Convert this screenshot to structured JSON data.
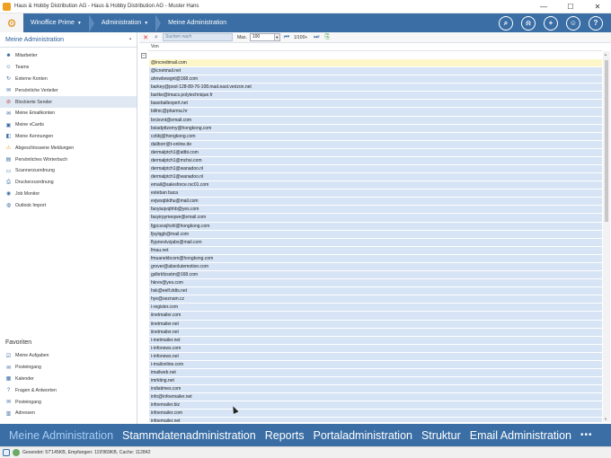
{
  "window": {
    "title": "Haus & Hobby Distribution AG - Haus & Hobby Distribution AG - Muster Hans",
    "minimize": "—",
    "maximize": "☐",
    "close": "✕"
  },
  "topnav": {
    "crumbs": [
      "Winoffice Prime",
      "Administration",
      "Meine Administration"
    ],
    "icons": [
      "search-icon",
      "bell-icon",
      "plus-icon",
      "user-icon",
      "help-icon"
    ],
    "search_glyph": "⌕",
    "bell_glyph": "⍾",
    "plus_glyph": "+",
    "user_glyph": "☺",
    "help_glyph": "?"
  },
  "sidebar": {
    "title": "Meine Administration",
    "pin": "▪",
    "items": [
      {
        "label": "Mitarbeiter",
        "icon": "person-icon"
      },
      {
        "label": "Teams",
        "icon": "team-icon"
      },
      {
        "label": "Externe Konten",
        "icon": "external-accounts-icon"
      },
      {
        "label": "Persönliche Verteiler",
        "icon": "distribution-list-icon"
      },
      {
        "label": "Blockierte Sender",
        "icon": "blocked-sender-icon"
      },
      {
        "label": "Meine Emailkonten",
        "icon": "mail-account-icon"
      },
      {
        "label": "Meine vCards",
        "icon": "vcard-icon"
      },
      {
        "label": "Meine Kennungen",
        "icon": "id-icon"
      },
      {
        "label": "Abgeschlossene Meldungen",
        "icon": "warning-icon"
      },
      {
        "label": "Persönliches Wörterbuch",
        "icon": "dictionary-icon"
      },
      {
        "label": "Scannerzuordnung",
        "icon": "scanner-icon"
      },
      {
        "label": "Druckerzuordnung",
        "icon": "printer-icon"
      },
      {
        "label": "Job Monitor",
        "icon": "job-monitor-icon"
      },
      {
        "label": "Outlook Import",
        "icon": "outlook-icon"
      }
    ],
    "active_index": 4,
    "favorites_title": "Favoriten",
    "favorites": [
      {
        "label": "Meine Aufgaben",
        "icon": "tasks-icon"
      },
      {
        "label": "Posteingang",
        "icon": "inbox-icon"
      },
      {
        "label": "Kalender",
        "icon": "calendar-icon"
      },
      {
        "label": "Fragen & Antworten",
        "icon": "faq-icon"
      },
      {
        "label": "Posteingang",
        "icon": "inbox-icon"
      },
      {
        "label": "Adressen",
        "icon": "address-icon"
      }
    ]
  },
  "toolbar": {
    "search_placeholder": "Suchen nach",
    "max_label": "Max.",
    "max_value": "100",
    "count": "1/100+"
  },
  "grid": {
    "column": "Von",
    "group_toggle": "−",
    "selected_index": 0,
    "rows": [
      "@incredimail.com",
      "@icnetmail.net",
      "ahnwbvwgnt@168.com",
      "barkey@pool-128-89-76-108.mad.east.verizon.net",
      "bartke@imacs.polytechnique.fr",
      "baseballexpert.net",
      "billmc@pharma.hr",
      "brcixvnt@email.com",
      "bsiadpttzemy@hongkong.com",
      "czbbj@hongkong.com",
      "daliborr@t-online.de",
      "dermalptch1@attbi.com",
      "dermalptch1@mchsi.com",
      "dermalptch1@wanadoo.nl",
      "dermalptch1@wanadoo.nl",
      "email@salesforce.rsc01.com",
      "esteban baca",
      "evjwxqbkthu@mail.com",
      "faoyiuqvqhhb@yes.com",
      "fasyirpymeqwe@email.com",
      "fgpcsosjhshl@hongkong.com",
      "fjsylqgb@mail.com",
      "flypnestvzjabx@mail.com",
      "fmau.net",
      "fmuanekbcom@hongkong.com",
      "grover@absolutemotion.com",
      "gslbrkfzsstm@168.com",
      "hkrev@yes.com",
      "hsk@eelf.ddts.net",
      "hye@seznam.cz",
      "i-register.com",
      "iinetmailer.com",
      "iinetmailer.net",
      "iinetmailer.net",
      "i-inetmailer.net",
      "i-infonews.com",
      "i-infonews.net",
      "i-mailonline.com",
      "imailweb.net",
      "imrkting.net",
      "indiatimes.com",
      "info@infoemailer.net",
      "infoemailer.biz",
      "infoemailer.com",
      "infoemailer.net"
    ]
  },
  "bottom_tabs": {
    "items": [
      "Meine Administration",
      "Stammdatenadministration",
      "Reports",
      "Portaladministration",
      "Struktur",
      "Email Administration"
    ],
    "active_index": 0,
    "more": "•••"
  },
  "status": {
    "text": "Gesendet: 57'145KB, Empfangen: 119'869KB, Cache: 112842"
  }
}
